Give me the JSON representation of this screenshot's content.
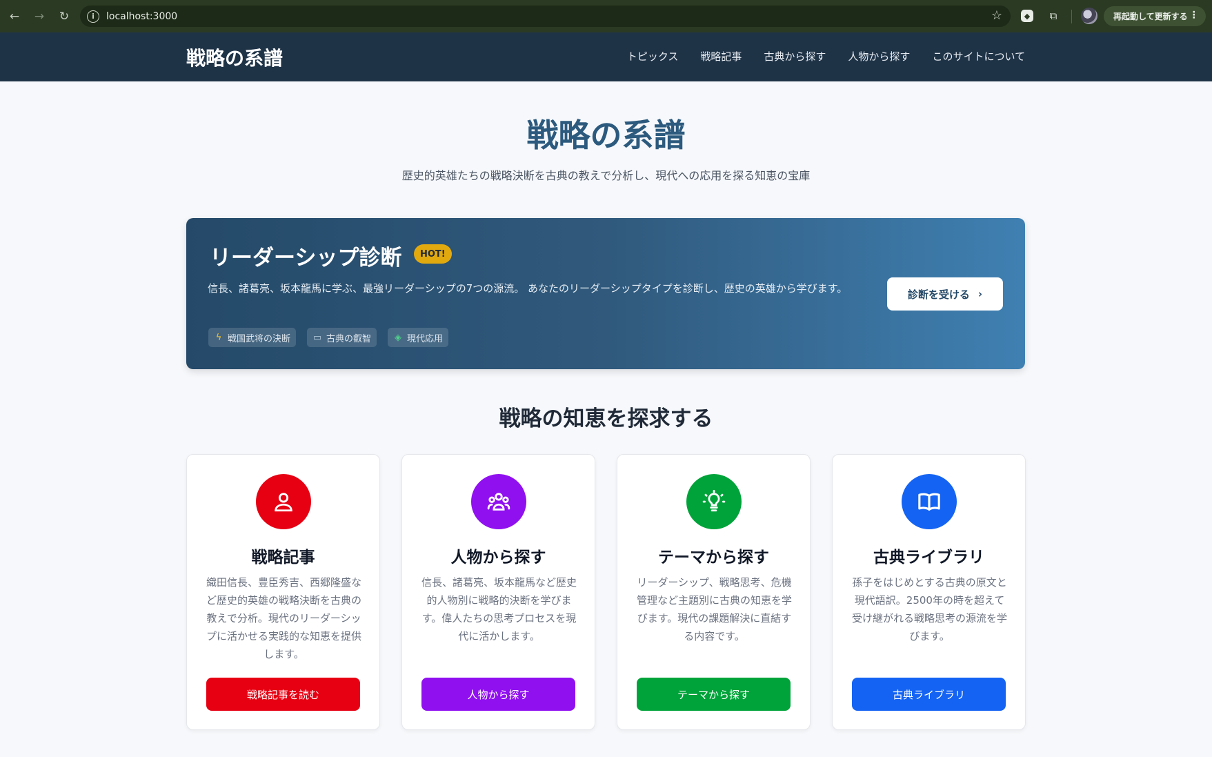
{
  "browser": {
    "url": "localhost:3000",
    "restart_label": "再起動して更新する"
  },
  "header": {
    "logo": "戦略の系譜",
    "nav": [
      "トピックス",
      "戦略記事",
      "古典から探す",
      "人物から探す",
      "このサイトについて"
    ]
  },
  "hero": {
    "title": "戦略の系譜",
    "subtitle": "歴史的英雄たちの戦略決断を古典の教えで分析し、現代への応用を探る知恵の宝庫"
  },
  "banner": {
    "title": "リーダーシップ診断",
    "badge": "HOT!",
    "description": "信長、諸葛亮、坂本龍馬に学ぶ、最強リーダーシップの7つの源流。 あなたのリーダーシップタイプを診断し、歴史の英雄から学びます。",
    "tags": [
      "戦国武将の決断",
      "古典の叡智",
      "現代応用"
    ],
    "cta": "診断を受ける"
  },
  "section": {
    "title": "戦略の知恵を探求する"
  },
  "cards": [
    {
      "title": "戦略記事",
      "description": "織田信長、豊臣秀吉、西郷隆盛など歴史的英雄の戦略決断を古典の教えで分析。現代のリーダーシップに活かせる実践的な知恵を提供します。",
      "button": "戦略記事を読む",
      "color": "#e60012",
      "icon": "user-icon"
    },
    {
      "title": "人物から探す",
      "description": "信長、諸葛亮、坂本龍馬など歴史的人物別に戦略的決断を学びます。偉人たちの思考プロセスを現代に活かします。",
      "button": "人物から探す",
      "color": "#9010f0",
      "icon": "users-icon"
    },
    {
      "title": "テーマから探す",
      "description": "リーダーシップ、戦略思考、危機管理など主題別に古典の知恵を学びます。現代の課題解決に直結する内容です。",
      "button": "テーマから探す",
      "color": "#00a33a",
      "icon": "lightbulb-icon"
    },
    {
      "title": "古典ライブラリ",
      "description": "孫子をはじめとする古典の原文と現代語訳。2500年の時を超えて受け継がれる戦略思考の源流を学びます。",
      "button": "古典ライブラリ",
      "color": "#1463f3",
      "icon": "book-icon"
    }
  ]
}
